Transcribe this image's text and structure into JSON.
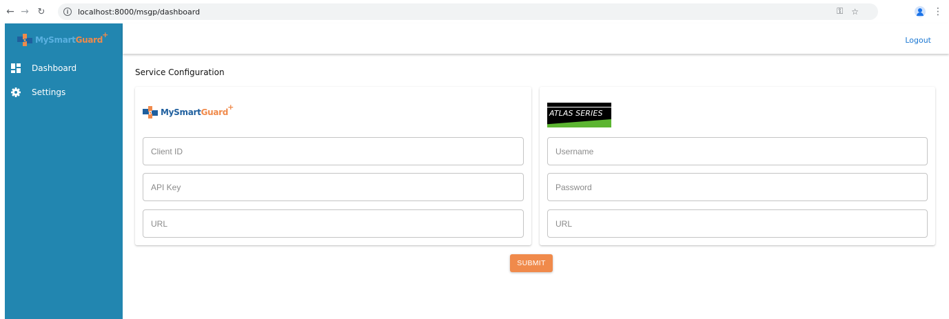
{
  "browser": {
    "url": "localhost:8000/msgp/dashboard"
  },
  "brand": {
    "word_part1": "MySmart",
    "word_part2": "Guard",
    "plus": "+"
  },
  "sidebar": {
    "items": [
      {
        "label": "Dashboard",
        "icon": "dashboard-icon"
      },
      {
        "label": "Settings",
        "icon": "gear-icon"
      }
    ]
  },
  "topbar": {
    "logout_label": "Logout"
  },
  "page": {
    "title": "Service Configuration"
  },
  "mysmartguard_card": {
    "fields": [
      {
        "placeholder": "Client ID"
      },
      {
        "placeholder": "API Key"
      },
      {
        "placeholder": "URL"
      }
    ]
  },
  "atlas_card": {
    "logo_text": "ATLAS SERIES",
    "fields": [
      {
        "placeholder": "Username"
      },
      {
        "placeholder": "Password"
      },
      {
        "placeholder": "URL"
      }
    ]
  },
  "submit_label": "SUBMIT",
  "colors": {
    "sidebar": "#2286b0",
    "accent": "#f08a4b",
    "brand_blue": "#1f5f9e",
    "atlas_green": "#5cb531",
    "link": "#1976d2"
  }
}
